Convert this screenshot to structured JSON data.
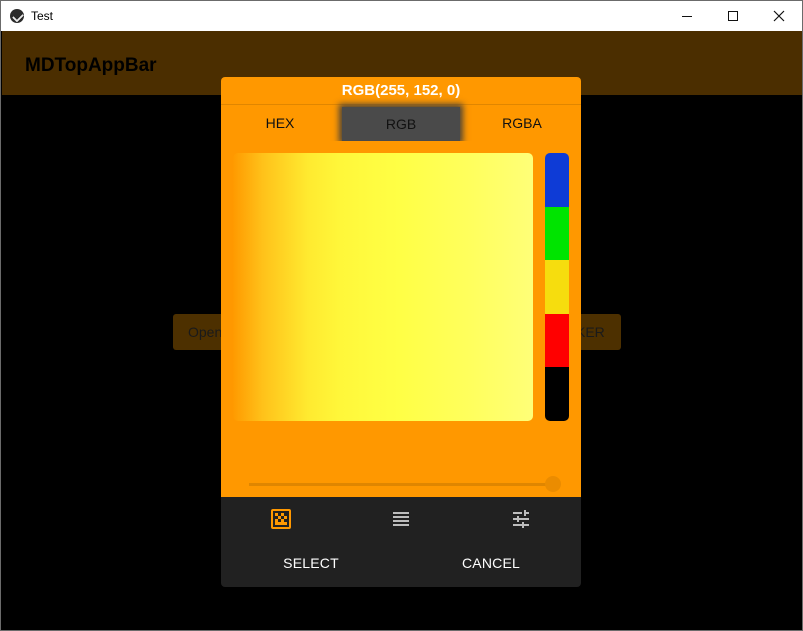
{
  "window": {
    "title": "Test",
    "icons": {
      "app": "kivy-app-icon",
      "minimize": "minimize-icon",
      "maximize": "maximize-icon",
      "close": "close-icon"
    }
  },
  "appbar": {
    "title": "MDTopAppBar"
  },
  "background_buttons": {
    "left_label": "Open",
    "right_label": "KER"
  },
  "picker": {
    "color_title": "RGB(255, 152, 0)",
    "selected_color": "#ff9800",
    "tabs": [
      {
        "label": "HEX",
        "active": false
      },
      {
        "label": "RGB",
        "active": true
      },
      {
        "label": "RGBA",
        "active": false
      }
    ],
    "hue_colors": [
      "#0e3bd6",
      "#00e400",
      "#f6dd0e",
      "#ff0000",
      "#000000"
    ],
    "opacity_slider": 1.0,
    "bottom_nav": [
      {
        "icon": "gradient-icon",
        "active": true
      },
      {
        "icon": "palette-list-icon",
        "active": false
      },
      {
        "icon": "tune-sliders-icon",
        "active": false
      }
    ],
    "actions": {
      "select": "SELECT",
      "cancel": "CANCEL"
    }
  }
}
